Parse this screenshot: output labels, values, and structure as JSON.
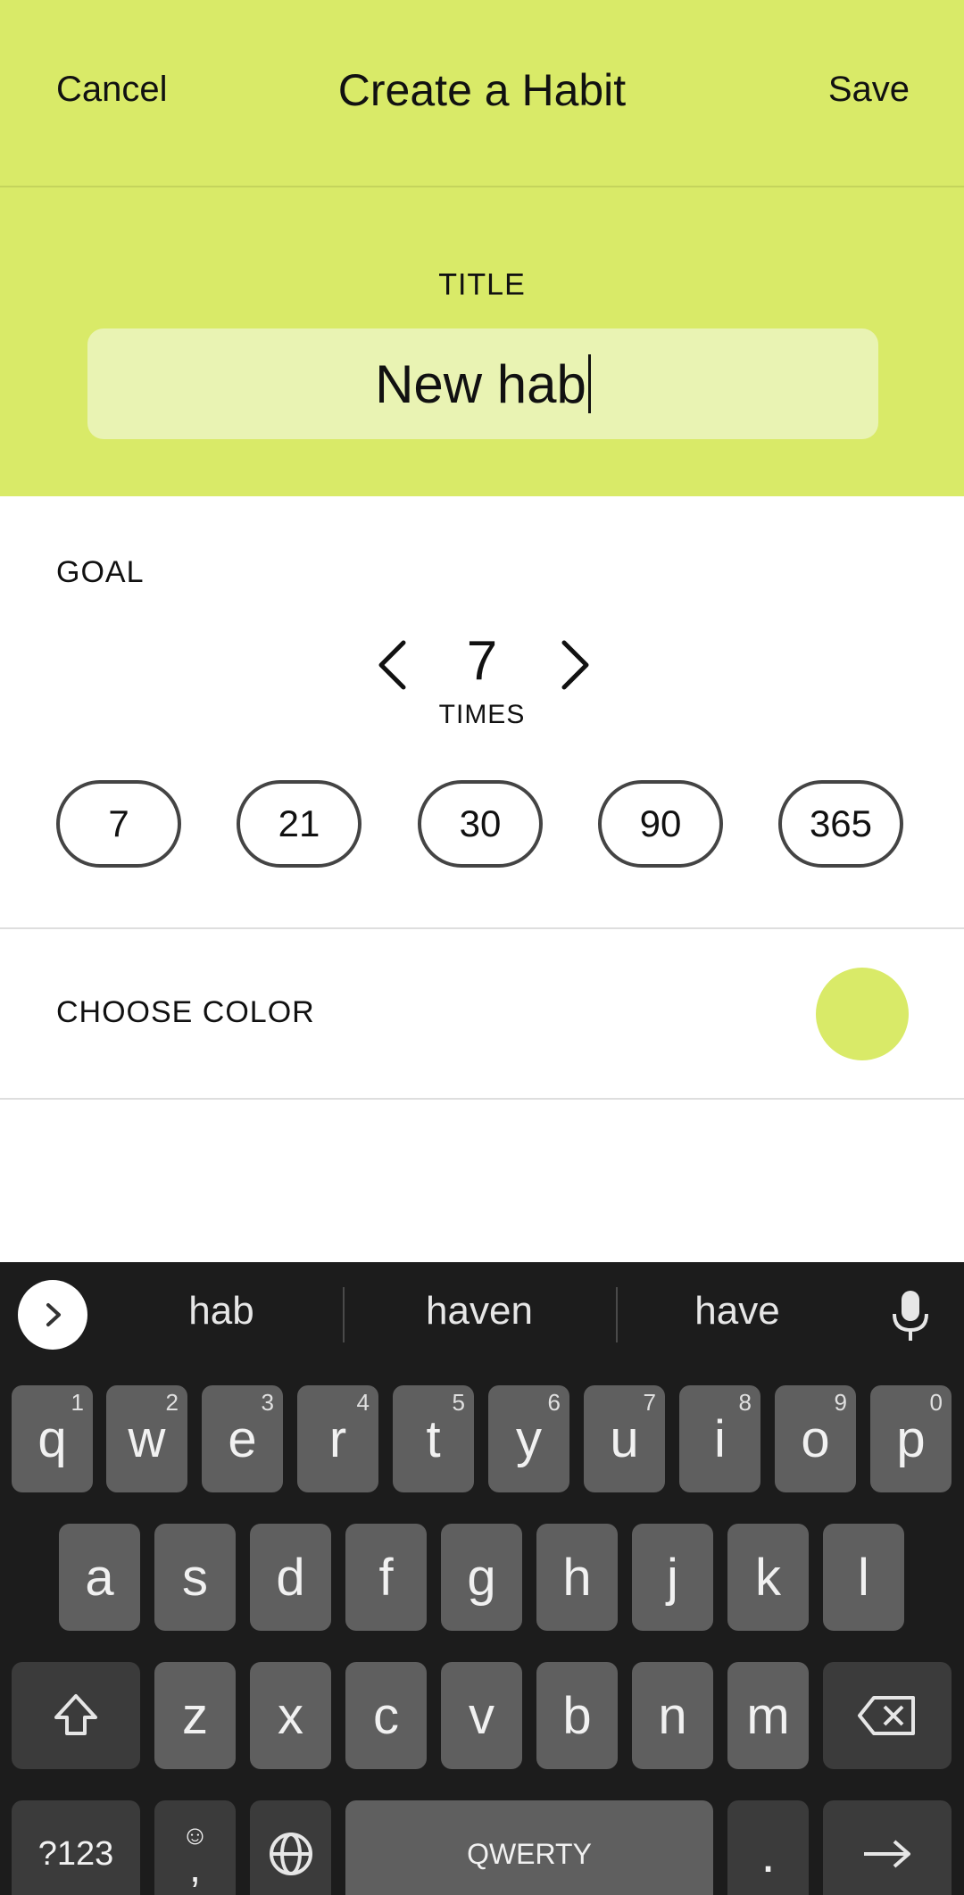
{
  "header": {
    "cancel_label": "Cancel",
    "title": "Create a Habit",
    "save_label": "Save"
  },
  "title_section": {
    "label": "TITLE",
    "value": "New hab"
  },
  "goal": {
    "label": "GOAL",
    "value": "7",
    "unit": "TIMES",
    "presets": [
      "7",
      "21",
      "30",
      "90",
      "365"
    ]
  },
  "color": {
    "label": "CHOOSE COLOR",
    "selected": "#d9ea68"
  },
  "keyboard": {
    "suggestions": [
      "hab",
      "haven",
      "have"
    ],
    "row1": [
      "q",
      "w",
      "e",
      "r",
      "t",
      "y",
      "u",
      "i",
      "o",
      "p"
    ],
    "row1_hints": [
      "1",
      "2",
      "3",
      "4",
      "5",
      "6",
      "7",
      "8",
      "9",
      "0"
    ],
    "row2": [
      "a",
      "s",
      "d",
      "f",
      "g",
      "h",
      "j",
      "k",
      "l"
    ],
    "row3": [
      "z",
      "x",
      "c",
      "v",
      "b",
      "n",
      "m"
    ],
    "symbols_label": "?123",
    "comma_label": ",",
    "emoji_label": "☺",
    "space_label": "QWERTY",
    "period_label": "."
  },
  "colors": {
    "accent": "#d9ea68",
    "input_bg": "#e9f3b3",
    "keyboard_bg": "#1c1c1c",
    "key_bg": "#5f5f5f",
    "key_dark": "#3b3b3b"
  }
}
